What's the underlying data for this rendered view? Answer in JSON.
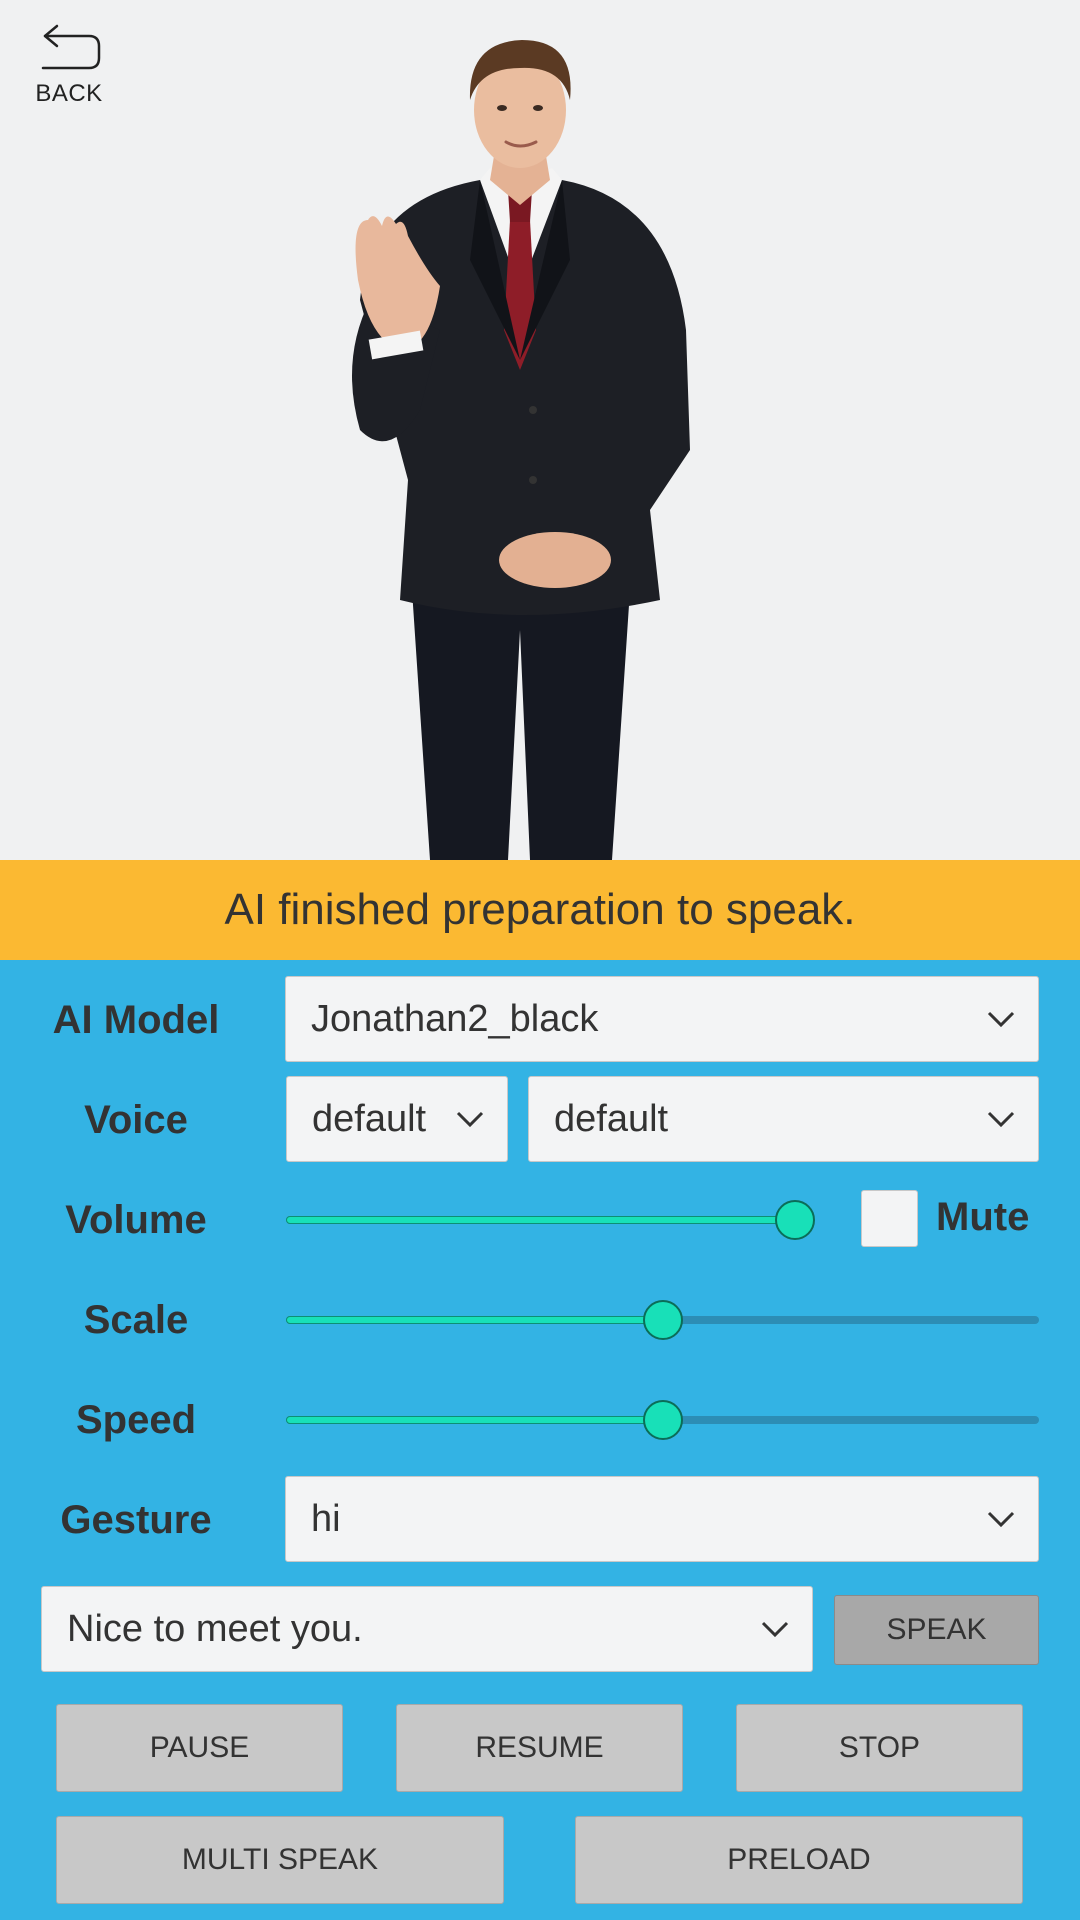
{
  "nav": {
    "back_label": "BACK"
  },
  "status": {
    "message": "AI finished preparation to speak."
  },
  "controls": {
    "ai_model": {
      "label": "AI Model",
      "selected": "Jonathan2_black"
    },
    "voice": {
      "label": "Voice",
      "language_selected": "default",
      "voice_selected": "default"
    },
    "volume": {
      "label": "Volume",
      "value": 0.97,
      "mute_label": "Mute",
      "muted": false
    },
    "scale": {
      "label": "Scale",
      "value": 0.5
    },
    "speed": {
      "label": "Speed",
      "value": 0.5
    },
    "gesture": {
      "label": "Gesture",
      "selected": "hi"
    },
    "speech": {
      "text_selected": "Nice to meet you.",
      "speak_label": "SPEAK"
    }
  },
  "buttons": {
    "pause": "PAUSE",
    "resume": "RESUME",
    "stop": "STOP",
    "multi_speak": "MULTI SPEAK",
    "preload": "PRELOAD"
  },
  "colors": {
    "status_bar": "#fbb932",
    "panel": "#33b3e4",
    "slider_fill": "#18e0b8",
    "button": "#c8c8c8",
    "speak_button": "#a8a8a8"
  }
}
